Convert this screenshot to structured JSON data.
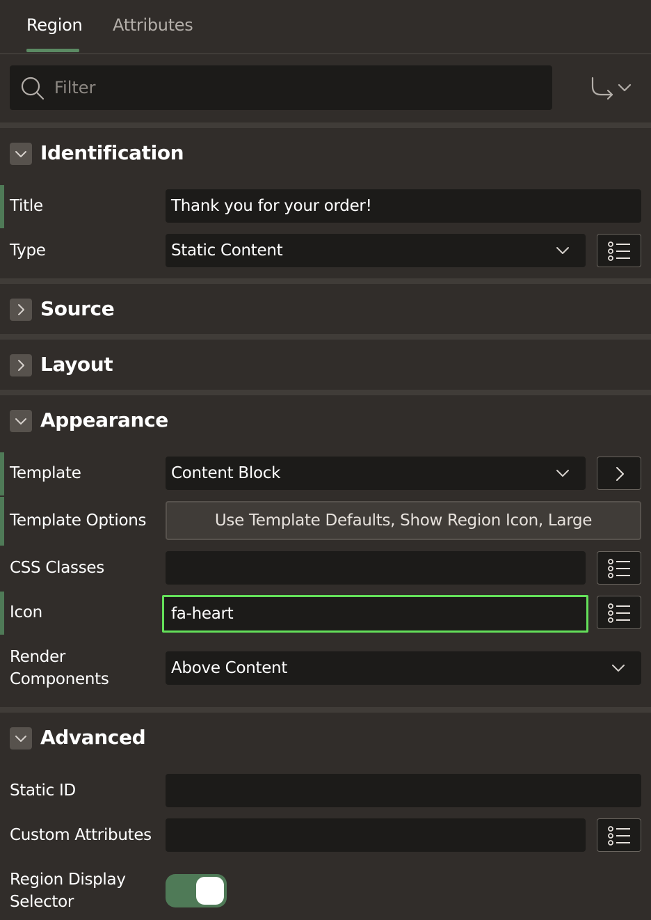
{
  "tabs": [
    {
      "label": "Region",
      "active": true
    },
    {
      "label": "Attributes",
      "active": false
    }
  ],
  "filter": {
    "placeholder": "Filter",
    "value": ""
  },
  "sections": {
    "identification": {
      "title": "Identification",
      "expanded": true,
      "title_label": "Title",
      "title_value": "Thank you for your order!",
      "type_label": "Type",
      "type_value": "Static Content"
    },
    "source": {
      "title": "Source",
      "expanded": false
    },
    "layout": {
      "title": "Layout",
      "expanded": false
    },
    "appearance": {
      "title": "Appearance",
      "expanded": true,
      "template_label": "Template",
      "template_value": "Content Block",
      "template_options_label": "Template Options",
      "template_options_value": "Use Template Defaults, Show Region Icon, Large",
      "css_classes_label": "CSS Classes",
      "css_classes_value": "",
      "icon_label": "Icon",
      "icon_value": "fa-heart",
      "render_components_label_line1": "Render",
      "render_components_label_line2": "Components",
      "render_components_value": "Above Content"
    },
    "advanced": {
      "title": "Advanced",
      "expanded": true,
      "static_id_label": "Static ID",
      "static_id_value": "",
      "custom_attributes_label": "Custom Attributes",
      "custom_attributes_value": "",
      "region_display_selector_label_line1": "Region Display",
      "region_display_selector_label_line2": "Selector",
      "region_display_selector_on": true
    }
  },
  "colors": {
    "background": "#312d2a",
    "field_background": "#1c1b19",
    "accent_green": "#5b8a63",
    "focus_green": "#64e05a"
  }
}
